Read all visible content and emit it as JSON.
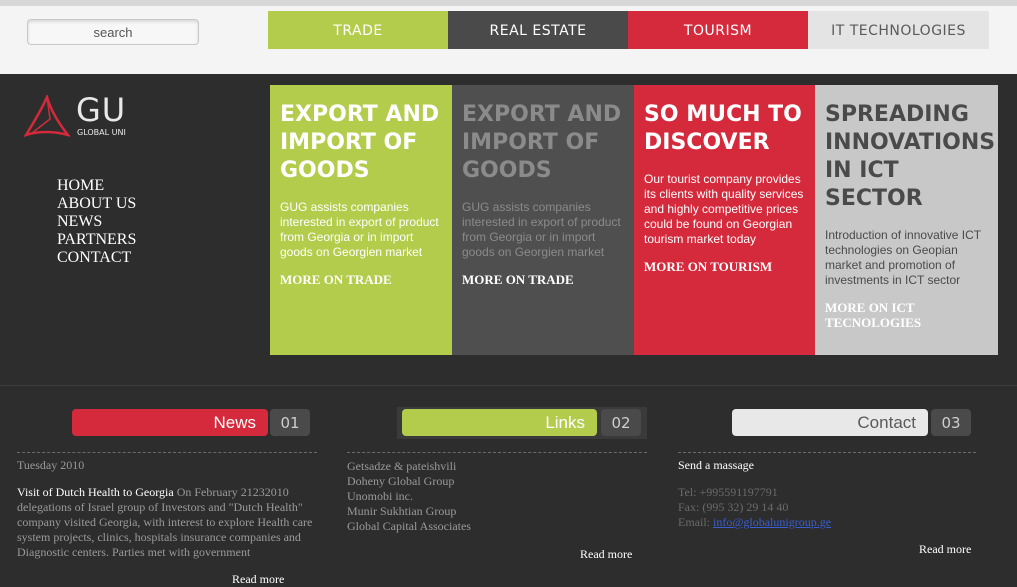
{
  "search": {
    "placeholder": "search"
  },
  "tabs": [
    {
      "label": "TRADE"
    },
    {
      "label": "REAL ESTATE"
    },
    {
      "label": "TOURISM"
    },
    {
      "label": "IT TECHNOLOGIES"
    }
  ],
  "logo": {
    "text": "GU",
    "subtitle": "GLOBAL UNI"
  },
  "nav": [
    {
      "label": "HOME"
    },
    {
      "label": "ABOUT US"
    },
    {
      "label": "NEWS"
    },
    {
      "label": "PARTNERS"
    },
    {
      "label": "CONTACT"
    }
  ],
  "panels": [
    {
      "title": "EXPORT AND IMPORT OF GOODS",
      "text": "GUG assists companies interested in export of product from Georgia or in import goods on Georgien market",
      "more": "MORE ON TRADE"
    },
    {
      "title": "EXPORT AND IMPORT OF GOODS",
      "text": "GUG assists companies interested in export of product from Georgia or in import goods on Georgien market",
      "more": "MORE ON TRADE"
    },
    {
      "title": "SO MUCH TO DISCOVER",
      "text": "Our tourist company provides its clients with quality services and highly competitive prices could be found on Georgian tourism market today",
      "more": "MORE ON TOURISM"
    },
    {
      "title": "SPREADING INNOVATIONS IN ICT SECTOR",
      "text": "Introduction of innovative ICT technologies on Geopian market and promotion of investments in ICT sector",
      "more": "MORE ON ICT TECNOLOGIES"
    }
  ],
  "news": {
    "heading": "News",
    "number": "01",
    "date": "Tuesday 2010",
    "headline": "Visit of Dutch Health to Georgia",
    "body": "On February 21232010 delegations of Israel group of Investors and \"Dutch Health\" company visited Georgia, with interest to explore Health care system projects, clinics, hospitals insurance companies and Diagnostic centers. Parties met with government",
    "read_more": "Read more"
  },
  "links": {
    "heading": "Links",
    "number": "02",
    "items": [
      "Getsadze & pateishvili",
      "Doheny Global Group",
      "Unomobi inc.",
      "Munir Sukhtian Group",
      "Global Capital Associates"
    ],
    "read_more": "Read more"
  },
  "contact": {
    "heading": "Contact",
    "number": "03",
    "send": "Send a massage",
    "tel": "Tel: +995591197791",
    "fax": "Fax: (995 32) 29 14 40",
    "email_label": "Email: ",
    "email": "info@globalunigroup.ge",
    "read_more": "Read more"
  },
  "colors": {
    "trade": "#b4cc4c",
    "real_estate": "#4a4a4a",
    "tourism": "#d42a3c",
    "it": "#e4e4e4",
    "background": "#2d2d2d"
  }
}
